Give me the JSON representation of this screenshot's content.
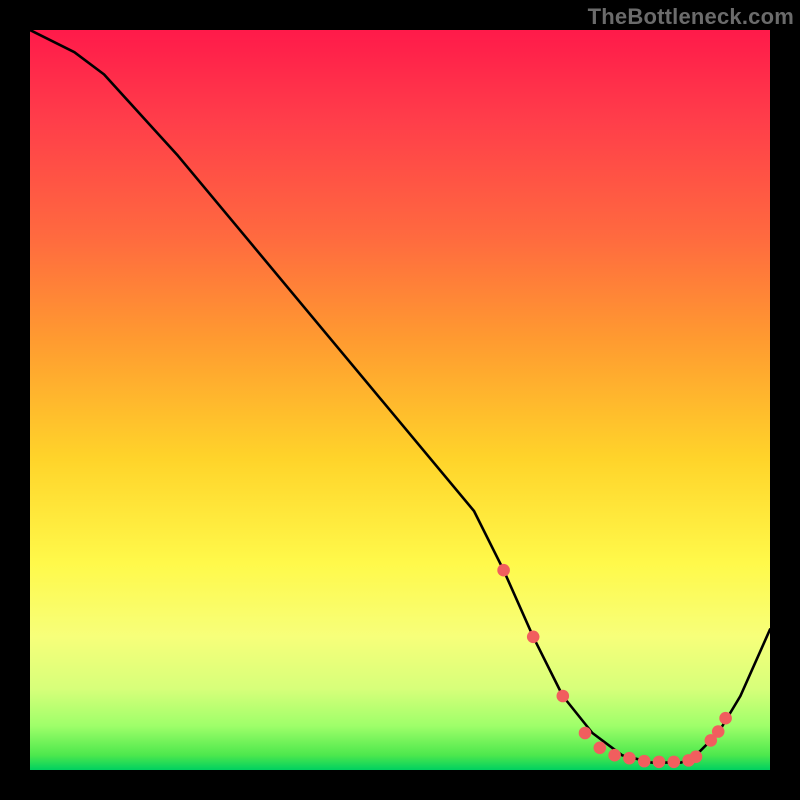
{
  "watermark": "TheBottleneck.com",
  "chart_data": {
    "type": "line",
    "title": "",
    "xlabel": "",
    "ylabel": "",
    "xlim": [
      0,
      100
    ],
    "ylim": [
      0,
      100
    ],
    "grid": false,
    "series": [
      {
        "name": "bottleneck-curve",
        "x": [
          0,
          6,
          10,
          20,
          30,
          40,
          50,
          60,
          64,
          68,
          72,
          76,
          80,
          84,
          88,
          90,
          93,
          96,
          100
        ],
        "values": [
          100,
          97,
          94,
          83,
          71,
          59,
          47,
          35,
          27,
          18,
          10,
          5,
          2,
          1,
          1,
          2,
          5,
          10,
          19
        ]
      }
    ],
    "markers": {
      "name": "highlight-dots",
      "x": [
        64,
        68,
        72,
        75,
        77,
        79,
        81,
        83,
        85,
        87,
        89,
        90,
        92,
        93,
        94
      ],
      "values": [
        27,
        18,
        10,
        5,
        3,
        2,
        1.6,
        1.2,
        1.1,
        1.1,
        1.3,
        1.8,
        4.0,
        5.2,
        7.0
      ]
    },
    "gradient_colors": {
      "top": "#ff1a4a",
      "mid1": "#ffd42a",
      "mid2": "#fff94a",
      "bottom": "#00d060"
    },
    "curve_color": "#000000",
    "marker_color": "#f15e5e"
  }
}
